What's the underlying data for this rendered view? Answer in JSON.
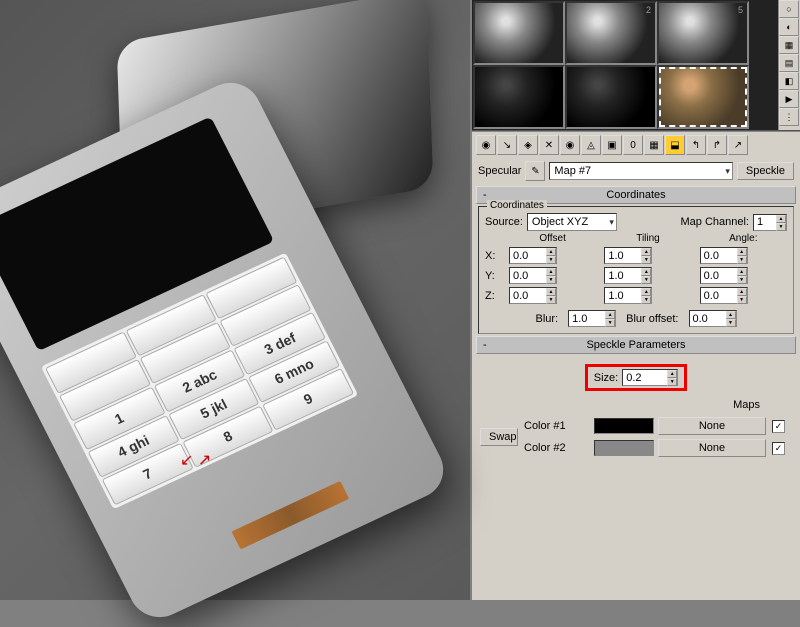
{
  "viewport": {
    "keys": [
      "",
      "",
      "",
      "",
      "",
      "",
      "1",
      "2 abc",
      "3 def",
      "4 ghi",
      "5 jkl",
      "6 mno",
      "7",
      "8",
      "9"
    ]
  },
  "materialSlots": {
    "slot1_num": "2",
    "slot2_num": "5"
  },
  "slotRow": {
    "channel": "Specular",
    "mapName": "Map #7",
    "mapType": "Speckle"
  },
  "coordinates": {
    "title": "Coordinates",
    "fieldset": "Coordinates",
    "sourceLabel": "Source:",
    "sourceValue": "Object XYZ",
    "mapChannelLabel": "Map Channel:",
    "mapChannelValue": "1",
    "headers": {
      "offset": "Offset",
      "tiling": "Tiling",
      "angle": "Angle:"
    },
    "axes": [
      "X:",
      "Y:",
      "Z:"
    ],
    "x": {
      "offset": "0.0",
      "tiling": "1.0",
      "angle": "0.0"
    },
    "y": {
      "offset": "0.0",
      "tiling": "1.0",
      "angle": "0.0"
    },
    "z": {
      "offset": "0.0",
      "tiling": "1.0",
      "angle": "0.0"
    },
    "blurLabel": "Blur:",
    "blurValue": "1.0",
    "blurOffsetLabel": "Blur offset:",
    "blurOffsetValue": "0.0"
  },
  "speckle": {
    "title": "Speckle Parameters",
    "sizeLabel": "Size:",
    "sizeValue": "0.2",
    "swap": "Swap",
    "mapsHeader": "Maps",
    "color1Label": "Color #1",
    "color2Label": "Color #2",
    "none": "None"
  }
}
